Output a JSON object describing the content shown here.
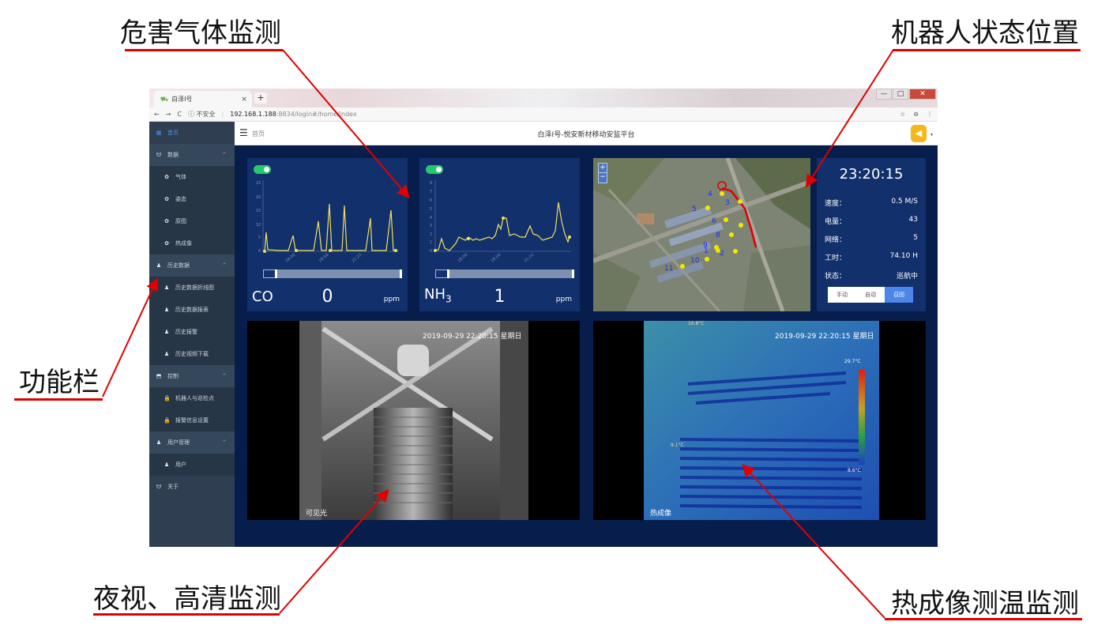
{
  "callouts": {
    "gas": "危害气体监测",
    "robot": "机器人状态位置",
    "func": "功能栏",
    "night": "夜视、高清监测",
    "thermal": "热成像测温监测"
  },
  "browser": {
    "tab_title": "白泽I号",
    "tab_close": "×",
    "new_tab": "+",
    "window_controls": [
      "—",
      "□",
      "✕"
    ],
    "nav": [
      "←",
      "→",
      "C"
    ],
    "security": "ⓘ 不安全",
    "url_host": "192.168.1.188",
    "url_rest": ":8834/login#/home/index",
    "addr_icons": [
      "☆",
      "⊖",
      "⋮"
    ]
  },
  "header": {
    "breadcrumb": "首页",
    "title": "白泽I号-悦安新材移动安监平台"
  },
  "sidebar": [
    {
      "icon": "▦",
      "label": "首页",
      "kind": "active"
    },
    {
      "icon": "ᗢ",
      "label": "数据",
      "kind": "group",
      "chev": "^"
    },
    {
      "icon": "✿",
      "label": "气体",
      "kind": "sub"
    },
    {
      "icon": "✿",
      "label": "姿态",
      "kind": "sub"
    },
    {
      "icon": "✿",
      "label": "原图",
      "kind": "sub"
    },
    {
      "icon": "✿",
      "label": "热成像",
      "kind": "sub"
    },
    {
      "icon": "♟",
      "label": "历史数据",
      "kind": "group",
      "chev": "^"
    },
    {
      "icon": "♟",
      "label": "历史数据折线图",
      "kind": "sub"
    },
    {
      "icon": "♟",
      "label": "历史数据报表",
      "kind": "sub"
    },
    {
      "icon": "♟",
      "label": "历史报警",
      "kind": "sub"
    },
    {
      "icon": "♟",
      "label": "历史视频下载",
      "kind": "sub"
    },
    {
      "icon": "⬒",
      "label": "控制",
      "kind": "group",
      "chev": "^"
    },
    {
      "icon": "🔒",
      "label": "机器人与巡检点",
      "kind": "sub"
    },
    {
      "icon": "🔒",
      "label": "报警信息设置",
      "kind": "sub"
    },
    {
      "icon": "♟",
      "label": "用户管理",
      "kind": "group",
      "chev": "^"
    },
    {
      "icon": "♟",
      "label": "用户",
      "kind": "sub"
    },
    {
      "icon": "ᗢ",
      "label": "关于",
      "kind": "plain"
    }
  ],
  "gas_panels": {
    "co": {
      "label": "CO",
      "value": "0",
      "unit": "ppm",
      "y_ticks": [
        "25",
        "20",
        "15",
        "10",
        "5",
        "0"
      ],
      "x_ticks": [
        "18:00",
        "18:56",
        "21:22"
      ]
    },
    "nh3": {
      "label": "NH",
      "sub": "3",
      "value": "1",
      "unit": "ppm",
      "y_ticks": [
        "8",
        "7",
        "6",
        "5",
        "4",
        "3",
        "2",
        "1",
        "0"
      ],
      "x_ticks": [
        "18:00",
        "18:56",
        "21:22"
      ]
    }
  },
  "map": {
    "zoom_in": "+",
    "zoom_out": "−",
    "points": [
      {
        "label": "4"
      },
      {
        "label": "3"
      },
      {
        "label": "5"
      },
      {
        "label": "6"
      },
      {
        "label": "8"
      },
      {
        "label": "9"
      },
      {
        "label": "1"
      },
      {
        "label": "2"
      },
      {
        "label": "10"
      },
      {
        "label": "11"
      }
    ]
  },
  "status": {
    "clock": "23:20:15",
    "rows": [
      {
        "key": "速度：",
        "val": "0.5 M/S"
      },
      {
        "key": "电量：",
        "val": "43"
      },
      {
        "key": "网络：",
        "val": "5"
      },
      {
        "key": "工时：",
        "val": "74.10 H"
      },
      {
        "key": "状态：",
        "val": "巡航中"
      }
    ],
    "modes": [
      "手动",
      "自动",
      "召回"
    ]
  },
  "videos": {
    "visible": {
      "timestamp": "2019-09-29 22:20:15 星期日",
      "label": "可见光"
    },
    "thermal": {
      "timestamp": "2019-09-29 22:20:15 星期日",
      "label": "热成像",
      "max_temp": "29.7°C",
      "min_temp": "8.6°C",
      "marker_a": "16.8°C",
      "marker_b": "9.1°C"
    }
  }
}
